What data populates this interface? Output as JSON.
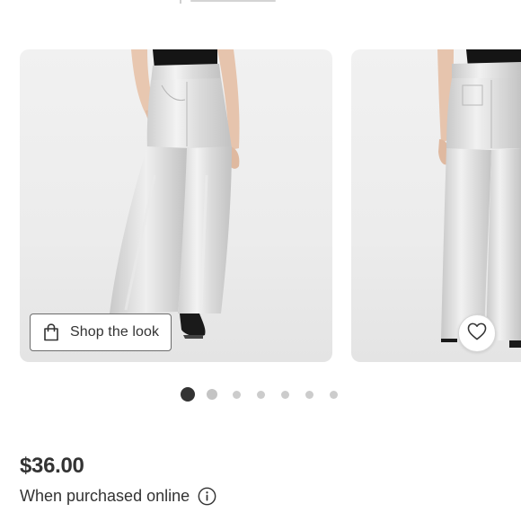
{
  "carousel": {
    "slides": [
      {
        "image": "silver-pants-front-photo"
      },
      {
        "image": "silver-pants-back-photo"
      }
    ],
    "shop_look_label": "Shop the look",
    "shop_look_icon": "shopping-bag-icon",
    "favorite_icon": "heart-icon",
    "page_count": 7,
    "active_index": 0
  },
  "product": {
    "price": "$36.00",
    "purchase_note": "When purchased online",
    "info_icon": "info-icon"
  },
  "colors": {
    "text": "#333333",
    "dot_active": "#333333",
    "dot_inactive": "#cccccc"
  }
}
